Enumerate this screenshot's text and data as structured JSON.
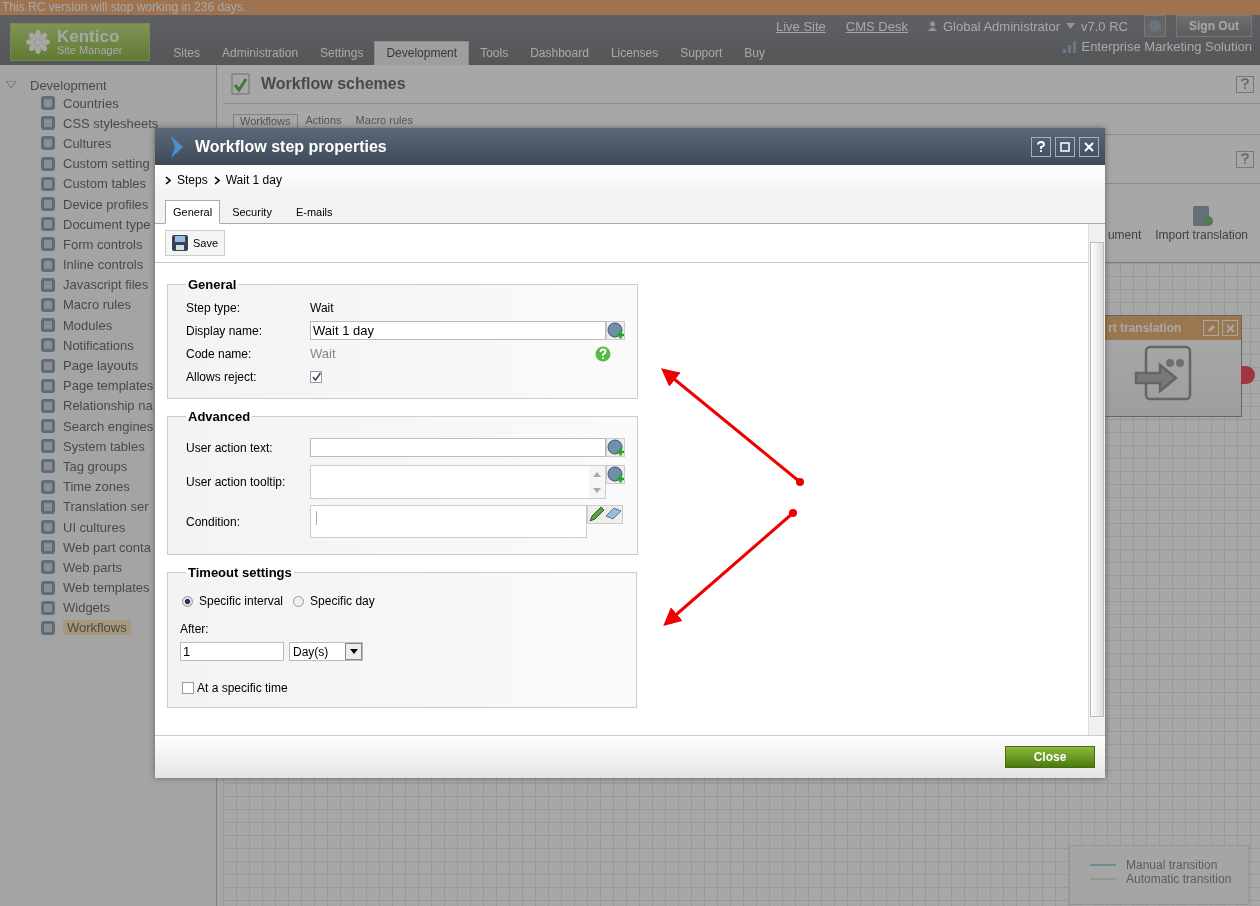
{
  "notice_bar": {
    "text": "This RC version will stop working in 236 days."
  },
  "header": {
    "logo": {
      "name": "Kentico",
      "subtitle": "Site Manager"
    },
    "tabs": [
      {
        "label": "Sites",
        "selected": false
      },
      {
        "label": "Administration",
        "selected": false
      },
      {
        "label": "Settings",
        "selected": false
      },
      {
        "label": "Development",
        "selected": true
      },
      {
        "label": "Tools",
        "selected": false
      },
      {
        "label": "Dashboard",
        "selected": false
      },
      {
        "label": "Licenses",
        "selected": false
      },
      {
        "label": "Support",
        "selected": false
      },
      {
        "label": "Buy",
        "selected": false
      }
    ],
    "links": [
      "Live Site",
      "CMS Desk"
    ],
    "user": "Global Administrator",
    "version": "v7.0 RC",
    "sign_out": "Sign Out",
    "edition": "Enterprise Marketing Solution"
  },
  "sidebar": {
    "root": "Development",
    "expanded": true,
    "items": [
      {
        "label": "Countries",
        "selected": false
      },
      {
        "label": "CSS stylesheets",
        "selected": false
      },
      {
        "label": "Cultures",
        "selected": false
      },
      {
        "label": "Custom setting",
        "selected": false
      },
      {
        "label": "Custom tables",
        "selected": false
      },
      {
        "label": "Device profiles",
        "selected": false
      },
      {
        "label": "Document type",
        "selected": false
      },
      {
        "label": "Form controls",
        "selected": false
      },
      {
        "label": "Inline controls",
        "selected": false
      },
      {
        "label": "Javascript files",
        "selected": false
      },
      {
        "label": "Macro rules",
        "selected": false
      },
      {
        "label": "Modules",
        "selected": false
      },
      {
        "label": "Notifications",
        "selected": false
      },
      {
        "label": "Page layouts",
        "selected": false
      },
      {
        "label": "Page templates",
        "selected": false
      },
      {
        "label": "Relationship na",
        "selected": false
      },
      {
        "label": "Search engines",
        "selected": false
      },
      {
        "label": "System tables",
        "selected": false
      },
      {
        "label": "Tag groups",
        "selected": false
      },
      {
        "label": "Time zones",
        "selected": false
      },
      {
        "label": "Translation ser",
        "selected": false
      },
      {
        "label": "UI cultures",
        "selected": false
      },
      {
        "label": "Web part conta",
        "selected": false
      },
      {
        "label": "Web parts",
        "selected": false
      },
      {
        "label": "Web templates",
        "selected": false
      },
      {
        "label": "Widgets",
        "selected": false
      },
      {
        "label": "Workflows",
        "selected": true
      }
    ]
  },
  "main": {
    "title": "Workflow schemes",
    "tabs": [
      {
        "label": "Workflows",
        "selected": true
      },
      {
        "label": "Actions",
        "selected": false
      },
      {
        "label": "Macro rules",
        "selected": false
      }
    ],
    "toolbar": [
      "ument",
      "Import translation"
    ],
    "canvas": {
      "node": {
        "title": "rt translation"
      },
      "legend": [
        "Manual transition",
        "Automatic transition"
      ]
    }
  },
  "dialog": {
    "title": "Workflow step properties",
    "breadcrumb": [
      "Steps",
      "Wait 1 day"
    ],
    "tabs": [
      {
        "label": "General",
        "selected": true
      },
      {
        "label": "Security",
        "selected": false
      },
      {
        "label": "E-mails",
        "selected": false
      }
    ],
    "save": "Save",
    "general": {
      "title": "General",
      "fields": [
        {
          "kind": "static",
          "label": "Step type:",
          "value": "Wait"
        },
        {
          "kind": "input",
          "label": "Display name:",
          "value": "Wait 1 day"
        },
        {
          "kind": "code",
          "label": "Code name:",
          "value": "Wait"
        },
        {
          "kind": "checkbox",
          "label": "Allows reject:",
          "checked": true
        }
      ]
    },
    "advanced": {
      "title": "Advanced",
      "fields": [
        {
          "kind": "input",
          "label": "User action text:"
        },
        {
          "kind": "textarea",
          "label": "User action tooltip:"
        },
        {
          "kind": "condition",
          "label": "Condition:"
        }
      ]
    },
    "timeout": {
      "title": "Timeout settings",
      "radios": [
        {
          "label": "Specific interval",
          "selected": true
        },
        {
          "label": "Specific day",
          "selected": false
        }
      ],
      "after_label": "After:",
      "after_value": "1",
      "unit": "Day(s)",
      "specific_time": {
        "label": "At a specific time",
        "checked": false
      }
    },
    "close": "Close"
  }
}
